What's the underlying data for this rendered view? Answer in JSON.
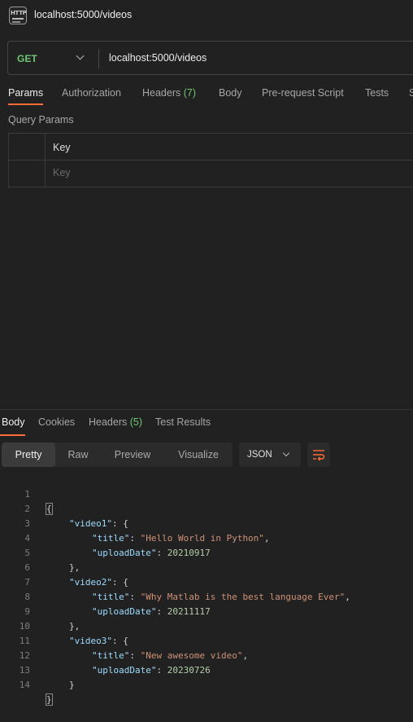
{
  "tab": {
    "title": "localhost:5000/videos",
    "icon": "http-icon"
  },
  "request": {
    "method": "GET",
    "url": "localhost:5000/videos",
    "method_color": "#6cc775"
  },
  "request_tabs": {
    "params": "Params",
    "authorization": "Authorization",
    "headers": "Headers",
    "headers_count": "(7)",
    "body": "Body",
    "prerequest": "Pre-request Script",
    "tests": "Tests",
    "settings_cut": "S"
  },
  "query_params": {
    "title": "Query Params",
    "key_header": "Key",
    "key_placeholder": "Key"
  },
  "response_tabs": {
    "body": "Body",
    "cookies": "Cookies",
    "headers": "Headers",
    "headers_count": "(5)",
    "test_results": "Test Results"
  },
  "format_buttons": {
    "pretty": "Pretty",
    "raw": "Raw",
    "preview": "Preview",
    "visualize": "Visualize",
    "language": "JSON"
  },
  "accent_color": "#ff6c37",
  "code": {
    "line_numbers": [
      "1",
      "2",
      "3",
      "4",
      "5",
      "6",
      "7",
      "8",
      "9",
      "10",
      "11",
      "12",
      "13",
      "14"
    ],
    "open_brace": "{",
    "close_brace": "}",
    "colon": ": ",
    "comma": ",",
    "obj_open": ": {",
    "obj_close_comma": "},",
    "obj_close": "}",
    "video1": {
      "key": "\"video1\"",
      "title_key": "\"title\"",
      "title_val": "\"Hello World in Python\"",
      "date_key": "\"uploadDate\"",
      "date_val": "20210917"
    },
    "video2": {
      "key": "\"video2\"",
      "title_key": "\"title\"",
      "title_val": "\"Why Matlab is the best language Ever\"",
      "date_key": "\"uploadDate\"",
      "date_val": "20211117"
    },
    "video3": {
      "key": "\"video3\"",
      "title_key": "\"title\"",
      "title_val": "\"New awesome video\"",
      "date_key": "\"uploadDate\"",
      "date_val": "20230726"
    }
  }
}
